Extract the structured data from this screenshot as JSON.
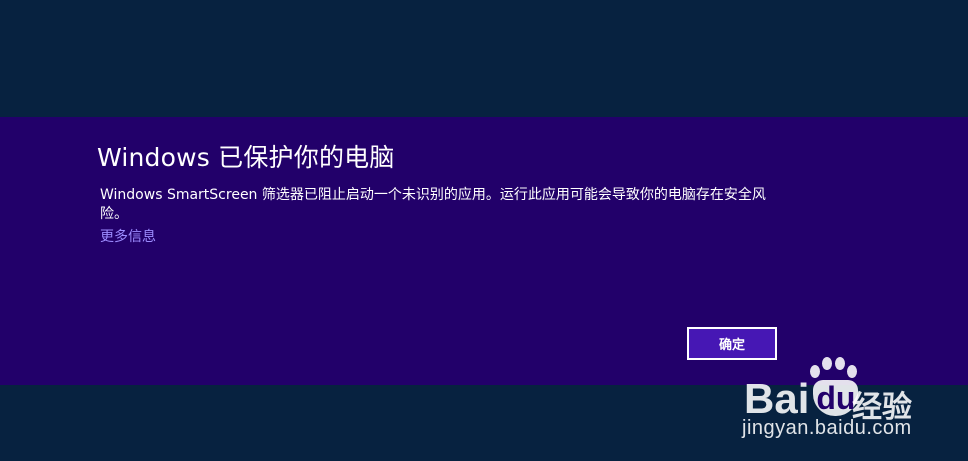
{
  "dialog": {
    "title": "Windows 已保护你的电脑",
    "message": "Windows SmartScreen 筛选器已阻止启动一个未识别的应用。运行此应用可能会导致你的电脑存在安全风险。",
    "more_info_link": "更多信息",
    "ok_button": "确定"
  },
  "watermark": {
    "logo_text_bai": "Bai",
    "logo_text_du": "du",
    "logo_text_jingyan": "经验",
    "url": "jingyan.baidu.com"
  },
  "colors": {
    "background": "#072240",
    "dialog_band": "#22006a",
    "button_fill": "#4617b4",
    "link": "#9d8cff",
    "text": "#ffffff"
  }
}
